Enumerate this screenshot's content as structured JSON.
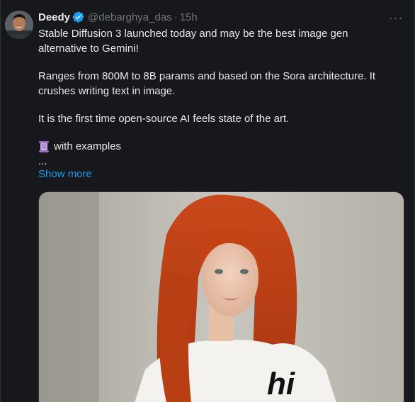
{
  "author": {
    "name": "Deedy",
    "handle": "@debarghya_das",
    "separator": "·",
    "time": "15h",
    "verified_icon": "verified-badge-icon",
    "avatar_icon": "avatar"
  },
  "menu": {
    "more_label": "···"
  },
  "tweet": {
    "line1": "Stable Diffusion 3 launched today and may be the best image gen",
    "line2": "alternative to Gemini!",
    "line3": "Ranges from 800M to 8B params and based on the Sora architecture. It",
    "line4": "crushes writing text in image.",
    "line5": "It is the first time open-source AI feels state of the art.",
    "line6": "with examples",
    "line7": "...",
    "show_more": "Show more"
  },
  "media": {
    "shirt_text": "hi"
  },
  "colors": {
    "background": "#16181c",
    "text": "#e7e9ea",
    "muted": "#71767b",
    "accent": "#1d9bf0"
  }
}
